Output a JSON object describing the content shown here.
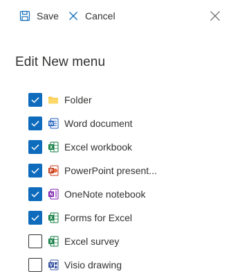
{
  "toolbar": {
    "save_label": "Save",
    "save_icon": "save-icon",
    "cancel_label": "Cancel",
    "cancel_icon": "cancel-x-icon",
    "close_icon": "close-icon"
  },
  "panel": {
    "title": "Edit New menu"
  },
  "items": [
    {
      "label": "Folder",
      "checked": true,
      "icon": "folder-icon"
    },
    {
      "label": "Word document",
      "checked": true,
      "icon": "word-icon"
    },
    {
      "label": "Excel workbook",
      "checked": true,
      "icon": "excel-icon"
    },
    {
      "label": "PowerPoint present...",
      "checked": true,
      "icon": "powerpoint-icon"
    },
    {
      "label": "OneNote notebook",
      "checked": true,
      "icon": "onenote-icon"
    },
    {
      "label": "Forms for Excel",
      "checked": true,
      "icon": "excel-icon"
    },
    {
      "label": "Excel survey",
      "checked": false,
      "icon": "excel-icon"
    },
    {
      "label": "Visio drawing",
      "checked": false,
      "icon": "visio-icon"
    }
  ],
  "colors": {
    "accent": "#0f6cbd",
    "text": "#323130",
    "folder": "#f7c948",
    "word": "#185abd",
    "excel": "#107c41",
    "powerpoint": "#c43e1c",
    "onenote": "#7719aa",
    "visio": "#3955a3"
  }
}
